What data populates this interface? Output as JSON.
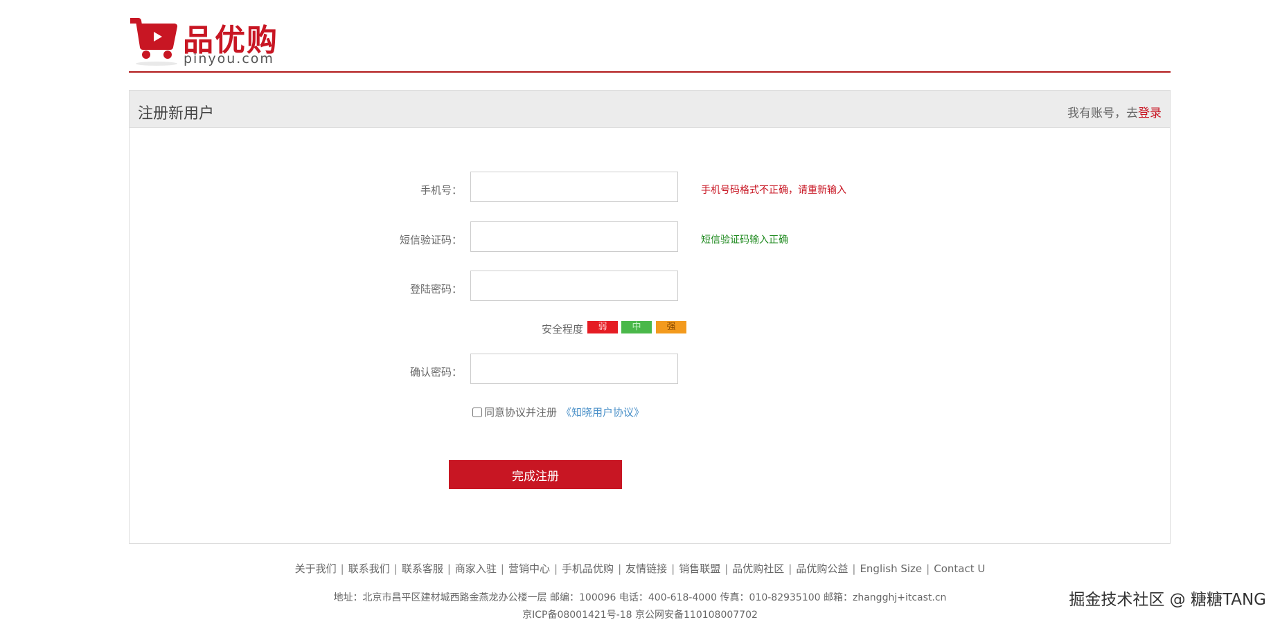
{
  "header": {
    "brand_name": "品优购",
    "brand_domain": "pinyou.com",
    "accent_color": "#c81623"
  },
  "panel": {
    "title": "注册新用户",
    "login_prompt": "我有账号，去",
    "login_link": "登录"
  },
  "form": {
    "phone": {
      "label": "手机号：",
      "value": "",
      "message": "手机号码格式不正确，请重新输入"
    },
    "sms": {
      "label": "短信验证码：",
      "value": "",
      "message": "短信验证码输入正确"
    },
    "password": {
      "label": "登陆密码：",
      "value": ""
    },
    "strength": {
      "label": "安全程度",
      "weak": "弱",
      "medium": "中",
      "strong": "强"
    },
    "confirm": {
      "label": "确认密码：",
      "value": ""
    },
    "agree": {
      "text": "同意协议并注册",
      "link": "《知晓用户协议》",
      "checked": false
    },
    "submit": "完成注册"
  },
  "footer": {
    "links": [
      "关于我们",
      "联系我们",
      "联系客服",
      "商家入驻",
      "营销中心",
      "手机品优购",
      "友情链接",
      "销售联盟",
      "品优购社区",
      "品优购公益",
      "English Size",
      "Contact U"
    ],
    "address": "地址：北京市昌平区建材城西路金燕龙办公楼一层 邮编：100096 电话：400-618-4000 传真：010-82935100 邮箱：zhangghj+itcast.cn",
    "icp": "京ICP备08001421号-18 京公网安备110108007702"
  },
  "watermark": "掘金技术社区 @ 糖糖TANG"
}
